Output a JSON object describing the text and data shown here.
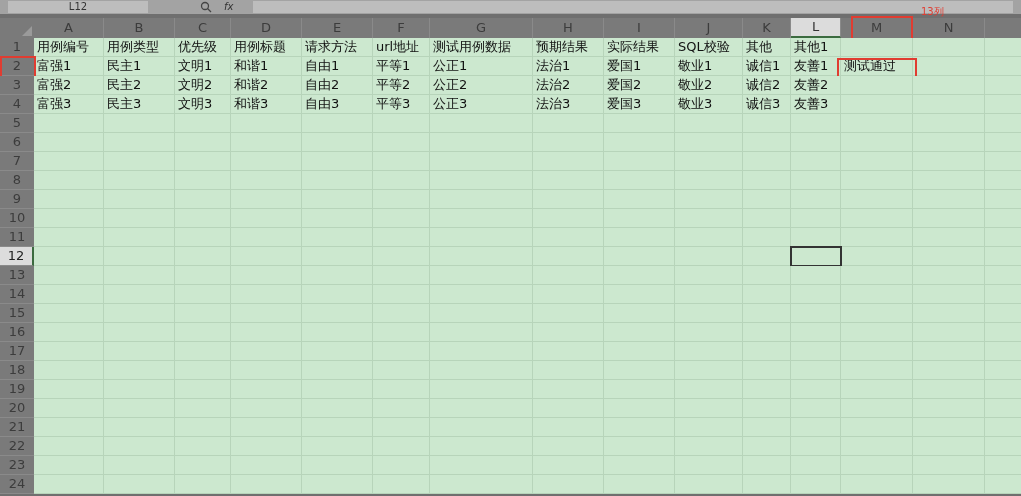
{
  "toolbar": {
    "name_box": "L12",
    "fx_label": "fx"
  },
  "columns": [
    {
      "label": "A",
      "selected": false
    },
    {
      "label": "B",
      "selected": false
    },
    {
      "label": "C",
      "selected": false
    },
    {
      "label": "D",
      "selected": false
    },
    {
      "label": "E",
      "selected": false
    },
    {
      "label": "F",
      "selected": false
    },
    {
      "label": "G",
      "selected": false
    },
    {
      "label": "H",
      "selected": false
    },
    {
      "label": "I",
      "selected": false
    },
    {
      "label": "J",
      "selected": false
    },
    {
      "label": "K",
      "selected": false
    },
    {
      "label": "L",
      "selected": true
    },
    {
      "label": "M",
      "selected": false,
      "annotated": true,
      "note": "13列"
    },
    {
      "label": "N",
      "selected": false
    },
    {
      "selected": false
    }
  ],
  "rows": [
    {
      "number": "1",
      "selected": false,
      "cells": [
        {
          "text": "用例编号"
        },
        {
          "text": "用例类型"
        },
        {
          "text": "优先级"
        },
        {
          "text": "用例标题"
        },
        {
          "text": "请求方法"
        },
        {
          "text": "url地址"
        },
        {
          "text": "测试用例数据"
        },
        {
          "text": "预期结果"
        },
        {
          "text": "实际结果"
        },
        {
          "text": "SQL校验"
        },
        {
          "text": "其他"
        },
        {
          "text": "其他1"
        }
      ]
    },
    {
      "number": "2",
      "selected": false,
      "annotated": true,
      "cells": [
        {
          "text": "富强1"
        },
        {
          "text": "民主1"
        },
        {
          "text": "文明1"
        },
        {
          "text": "和谐1"
        },
        {
          "text": "自由1"
        },
        {
          "text": "平等1"
        },
        {
          "text": "公正1"
        },
        {
          "text": "法治1"
        },
        {
          "text": "爱国1"
        },
        {
          "text": "敬业1"
        },
        {
          "text": "诚信1"
        },
        {
          "text": "友善1"
        },
        {
          "text": "测试通过",
          "annotated": true
        }
      ]
    },
    {
      "number": "3",
      "selected": false,
      "cells": [
        {
          "text": "富强2"
        },
        {
          "text": "民主2"
        },
        {
          "text": "文明2"
        },
        {
          "text": "和谐2"
        },
        {
          "text": "自由2"
        },
        {
          "text": "平等2"
        },
        {
          "text": "公正2"
        },
        {
          "text": "法治2"
        },
        {
          "text": "爱国2"
        },
        {
          "text": "敬业2"
        },
        {
          "text": "诚信2"
        },
        {
          "text": "友善2"
        }
      ]
    },
    {
      "number": "4",
      "selected": false,
      "cells": [
        {
          "text": "富强3"
        },
        {
          "text": "民主3"
        },
        {
          "text": "文明3"
        },
        {
          "text": "和谐3"
        },
        {
          "text": "自由3"
        },
        {
          "text": "平等3"
        },
        {
          "text": "公正3"
        },
        {
          "text": "法治3"
        },
        {
          "text": "爱国3"
        },
        {
          "text": "敬业3"
        },
        {
          "text": "诚信3"
        },
        {
          "text": "友善3"
        }
      ]
    },
    {
      "number": "5",
      "selected": false
    },
    {
      "number": "6",
      "selected": false
    },
    {
      "number": "7",
      "selected": false
    },
    {
      "number": "8",
      "selected": false
    },
    {
      "number": "9",
      "selected": false
    },
    {
      "number": "10",
      "selected": false
    },
    {
      "number": "11",
      "selected": false
    },
    {
      "number": "12",
      "selected": true
    },
    {
      "number": "13",
      "selected": false
    },
    {
      "number": "14",
      "selected": false
    },
    {
      "number": "15",
      "selected": false
    },
    {
      "number": "16",
      "selected": false
    },
    {
      "number": "17",
      "selected": false
    },
    {
      "number": "18",
      "selected": false
    },
    {
      "number": "19",
      "selected": false
    },
    {
      "number": "20",
      "selected": false
    },
    {
      "number": "21",
      "selected": false
    },
    {
      "number": "22",
      "selected": false
    },
    {
      "number": "23",
      "selected": false
    },
    {
      "number": "24",
      "selected": false
    }
  ]
}
